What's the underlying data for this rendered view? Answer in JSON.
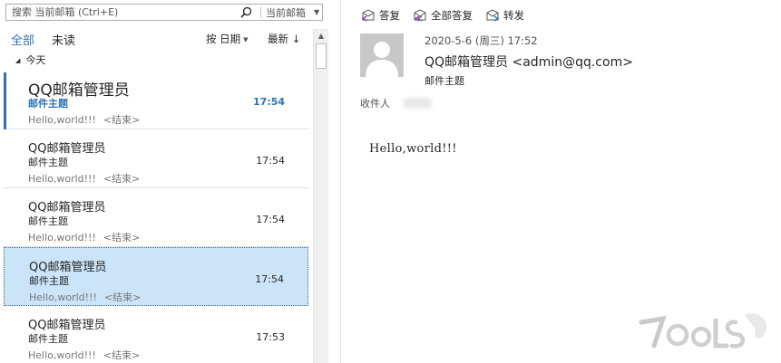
{
  "search": {
    "placeholder": "搜索 当前邮箱 (Ctrl+E)",
    "scope": "当前邮箱"
  },
  "filters": {
    "all": "全部",
    "unread": "未读",
    "sort_by": "按 日期",
    "order": "最新 ↓"
  },
  "group": {
    "label": "今天"
  },
  "messages": [
    {
      "sender": "QQ邮箱管理员",
      "subject": "邮件主题",
      "preview": "Hello,world!!!",
      "end": "<结束>",
      "time": "17:54",
      "state": "unread"
    },
    {
      "sender": "QQ邮箱管理员",
      "subject": "邮件主题",
      "preview": "Hello,world!!!",
      "end": "<结束>",
      "time": "17:54",
      "state": "read"
    },
    {
      "sender": "QQ邮箱管理员",
      "subject": "邮件主题",
      "preview": "Hello,world!!!",
      "end": "<结束>",
      "time": "17:54",
      "state": "read"
    },
    {
      "sender": "QQ邮箱管理员",
      "subject": "邮件主题",
      "preview": "Hello,world!!!",
      "end": "<结束>",
      "time": "17:54",
      "state": "selected"
    },
    {
      "sender": "QQ邮箱管理员",
      "subject": "邮件主题",
      "preview": "Hello,world!!!",
      "end": "<结束>",
      "time": "17:53",
      "state": "read"
    }
  ],
  "reading": {
    "toolbar": {
      "reply": "答复",
      "reply_all": "全部答复",
      "forward": "转发"
    },
    "date": "2020-5-6 (周三) 17:52",
    "from": "QQ邮箱管理员 <admin@qq.com>",
    "subject": "邮件主题",
    "recipients_label": "收件人",
    "body": "Hello,world!!!"
  },
  "colors": {
    "accent": "#2b73b8",
    "selected_bg": "#cce4f7",
    "divider": "#e1e1e1"
  }
}
